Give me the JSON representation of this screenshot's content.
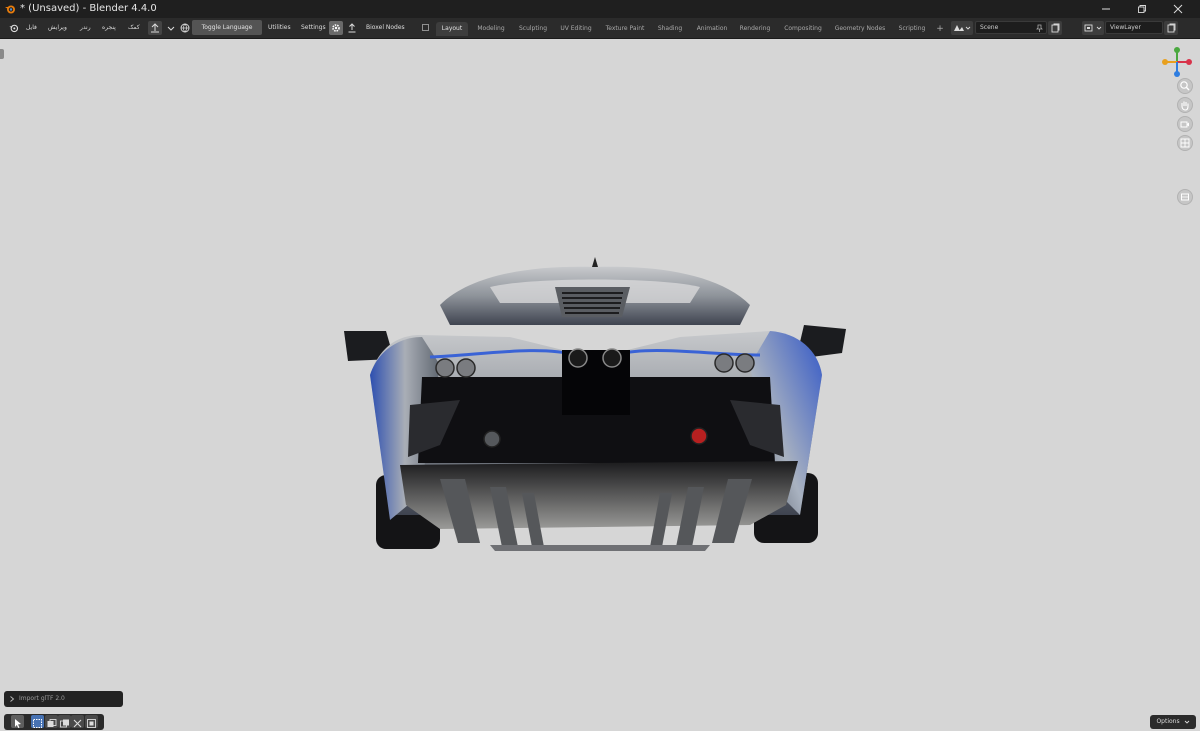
{
  "window": {
    "title": "* (Unsaved) - Blender 4.4.0",
    "minimize_icon": "minimize-icon",
    "maximize_icon": "restore-icon",
    "close_icon": "close-icon"
  },
  "menus": [
    "فایل",
    "ویرایش",
    "رندر",
    "پنجره",
    "کمک"
  ],
  "toolbar": {
    "toggle_language": "Toggle Language",
    "utilities": "Utilities",
    "settings": "Settings",
    "bioxel_nodes": "Bioxel Nodes"
  },
  "workspaces": [
    "Layout",
    "Modeling",
    "Sculpting",
    "UV Editing",
    "Texture Paint",
    "Shading",
    "Animation",
    "Rendering",
    "Compositing",
    "Geometry Nodes",
    "Scripting"
  ],
  "active_workspace": "Layout",
  "add_workspace": "+",
  "scene": {
    "value": "Scene"
  },
  "view_layer": {
    "value": "ViewLayer"
  },
  "viewport": {
    "background": "#d6d6d6",
    "nav_icons": [
      "axis-gizmo-icon",
      "zoom-icon",
      "pan-hand-icon",
      "camera-icon",
      "perspective-grid-icon",
      "toggle-camera-icon"
    ]
  },
  "operator_panel": {
    "label": "Import glTF 2.0"
  },
  "status": {
    "options": "Options"
  },
  "colors": {
    "accent_blue": "#4772b3",
    "header_bg": "#2b2b2b",
    "titlebar_bg": "#1f1f1f"
  }
}
